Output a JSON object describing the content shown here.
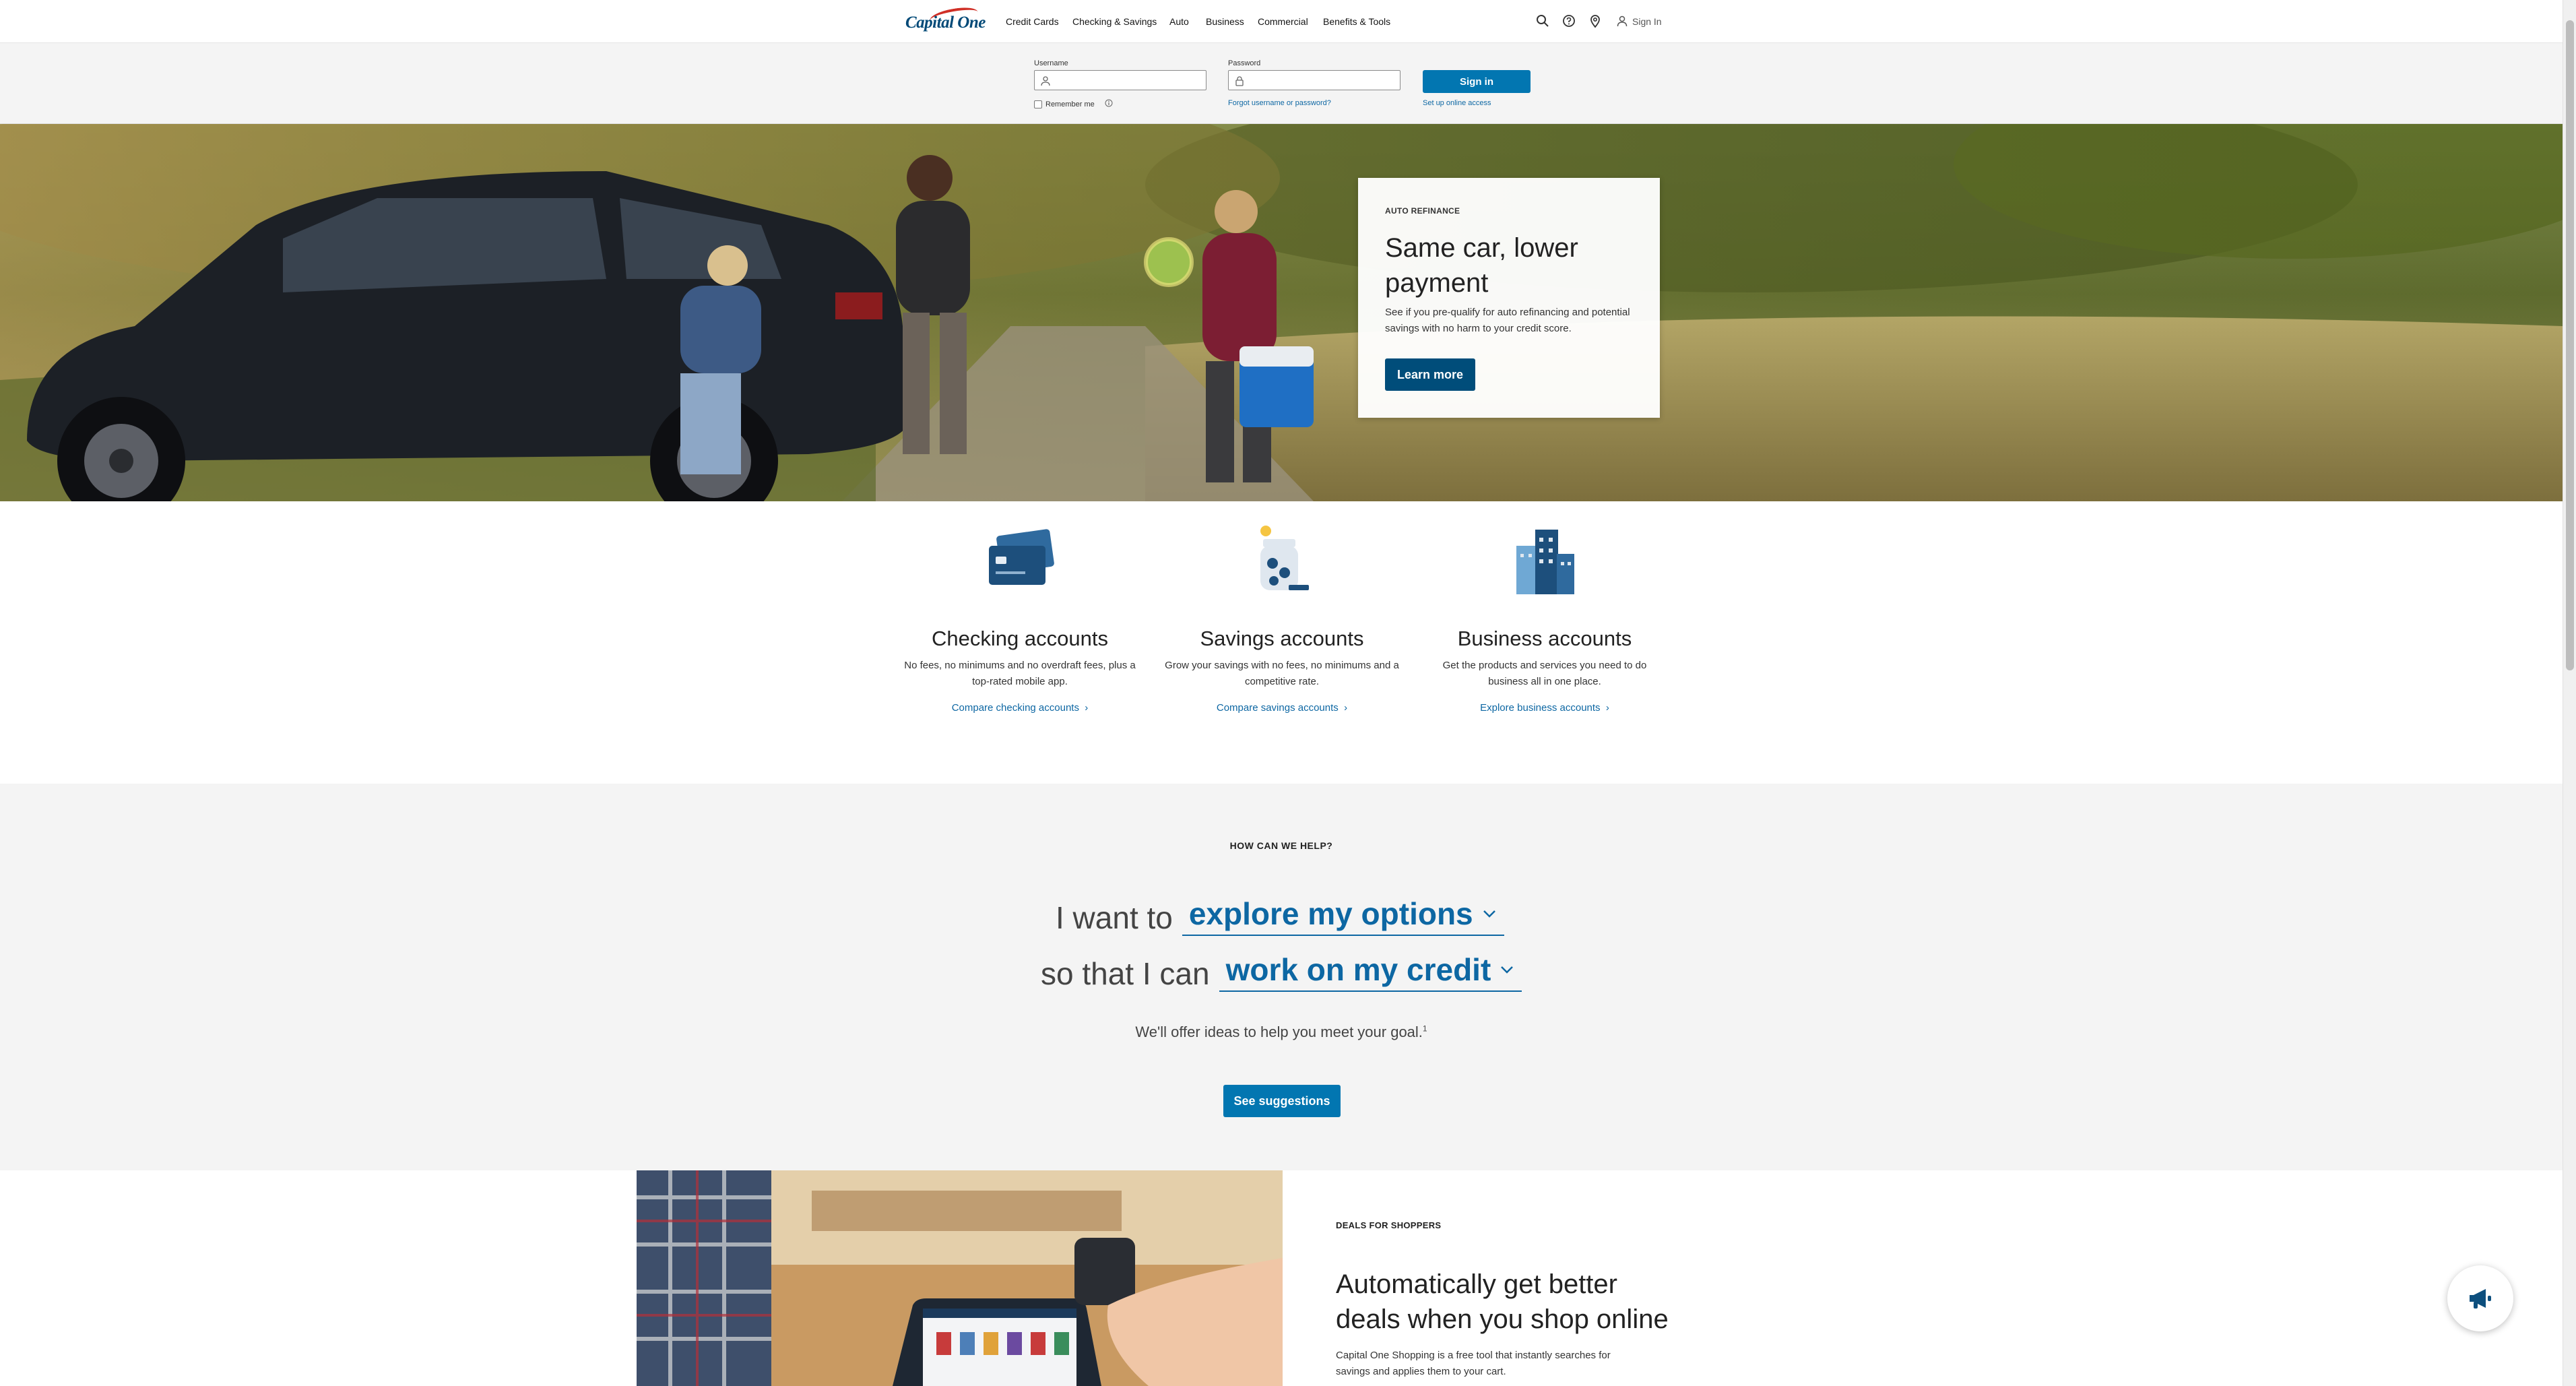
{
  "nav": {
    "logo_text": "Capital One",
    "items": [
      "Credit Cards",
      "Checking & Savings",
      "Auto",
      "Business",
      "Commercial",
      "Benefits & Tools"
    ],
    "icons": [
      "search-icon",
      "help-icon",
      "location-icon"
    ],
    "signin_label": "Sign In"
  },
  "login": {
    "username_label": "Username",
    "password_label": "Password",
    "signin_button": "Sign in",
    "remember_label": "Remember me",
    "forgot_link": "Forgot username or password?",
    "setup_link": "Set up online access"
  },
  "hero": {
    "eyebrow": "AUTO REFINANCE",
    "title": "Same car, lower payment",
    "body": "See if you pre-qualify for auto refinancing and potential savings with no harm to your credit score.",
    "button": "Learn more"
  },
  "accounts": [
    {
      "title": "Checking accounts",
      "desc": "No fees, no minimums and no overdraft fees, plus a top-rated mobile app.",
      "link": "Compare checking accounts"
    },
    {
      "title": "Savings accounts",
      "desc": "Grow your savings with no fees, no minimums and a competitive rate.",
      "link": "Compare savings accounts"
    },
    {
      "title": "Business accounts",
      "desc": "Get the products and services you need to do business all in one place.",
      "link": "Explore business accounts"
    }
  ],
  "help": {
    "eyebrow": "HOW CAN WE HELP?",
    "prefix1": "I want to",
    "select1": "explore my options",
    "prefix2": "so that I can",
    "select2": "work on my credit",
    "note": "We'll offer ideas to help you meet your goal.",
    "note_sup": "1",
    "button": "See suggestions"
  },
  "deals": {
    "eyebrow": "DEALS FOR SHOPPERS",
    "title": "Automatically get better deals when you shop online",
    "body": "Capital One Shopping is a free tool that instantly searches for savings and applies them to your cart."
  },
  "colors": {
    "brand_navy": "#004977",
    "brand_red": "#d03027",
    "button_blue": "#0276b1",
    "link_blue": "#0d67a3",
    "section_gray": "#f4f4f4"
  }
}
